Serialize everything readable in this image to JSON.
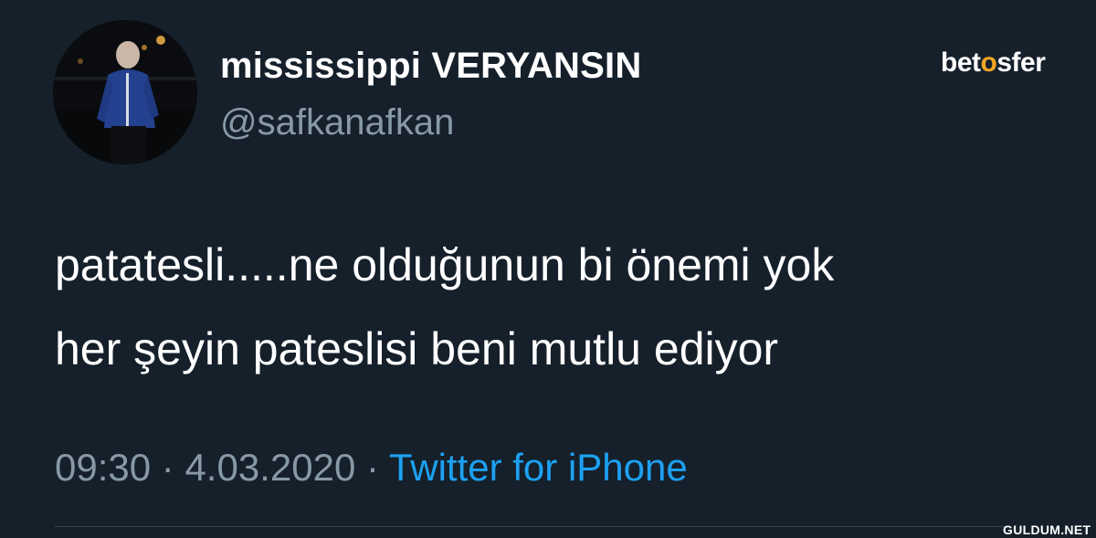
{
  "tweet": {
    "display_name": "mississippi VERYANSIN",
    "handle": "@safkanafkan",
    "text_lines": [
      "patatesli.....ne olduğunun bi önemi yok",
      "her şeyin pateslisi beni mutlu ediyor"
    ],
    "time": "09:30",
    "separator": "·",
    "date": "4.03.2020",
    "source": "Twitter for iPhone"
  },
  "overlays": {
    "brand_logo": "betosfer",
    "watermark": "GULDUM.NET"
  },
  "colors": {
    "background": "#15202b",
    "primary_text": "#ffffff",
    "secondary_text": "#8899a6",
    "accent": "#1da1f2",
    "brand_accent": "#f5a623"
  }
}
